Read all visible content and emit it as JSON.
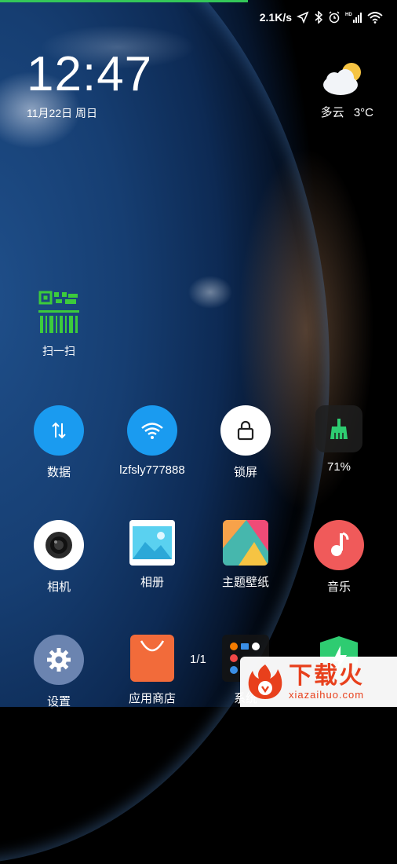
{
  "status_bar": {
    "network_speed": "2.1K/s",
    "icons": [
      "location-arrow-icon",
      "bluetooth-icon",
      "alarm-icon",
      "hd-signal-icon",
      "wifi-icon"
    ]
  },
  "clock": {
    "time": "12:47",
    "date": "11月22日 周日"
  },
  "weather": {
    "condition": "多云",
    "temperature": "3°C",
    "icon": "partly-cloudy-icon"
  },
  "scan_widget": {
    "label": "扫一扫",
    "icon": "qr-code-icon"
  },
  "toggles": [
    {
      "label": "数据",
      "icon": "data-arrows-icon",
      "color": "#1a9bf0"
    },
    {
      "label": "lzfsly777888",
      "icon": "wifi-icon",
      "color": "#1a9bf0"
    },
    {
      "label": "锁屏",
      "icon": "lock-icon",
      "color": "#ffffff"
    },
    {
      "label": "71%",
      "icon": "broom-icon",
      "color": "#2ecc71"
    }
  ],
  "apps_row1": [
    {
      "label": "相机",
      "icon": "camera-icon"
    },
    {
      "label": "相册",
      "icon": "gallery-icon"
    },
    {
      "label": "主题壁纸",
      "icon": "themes-icon"
    },
    {
      "label": "音乐",
      "icon": "music-icon"
    }
  ],
  "apps_row2": [
    {
      "label": "设置",
      "icon": "settings-gear-icon"
    },
    {
      "label": "应用商店",
      "icon": "shopping-bag-icon"
    },
    {
      "label": "系统",
      "icon": "system-folder-icon"
    },
    {
      "label": "",
      "icon": "security-shield-icon"
    }
  ],
  "pager": "1/1",
  "watermark": {
    "big": "下载火",
    "small": "xiazaihuo.com"
  }
}
